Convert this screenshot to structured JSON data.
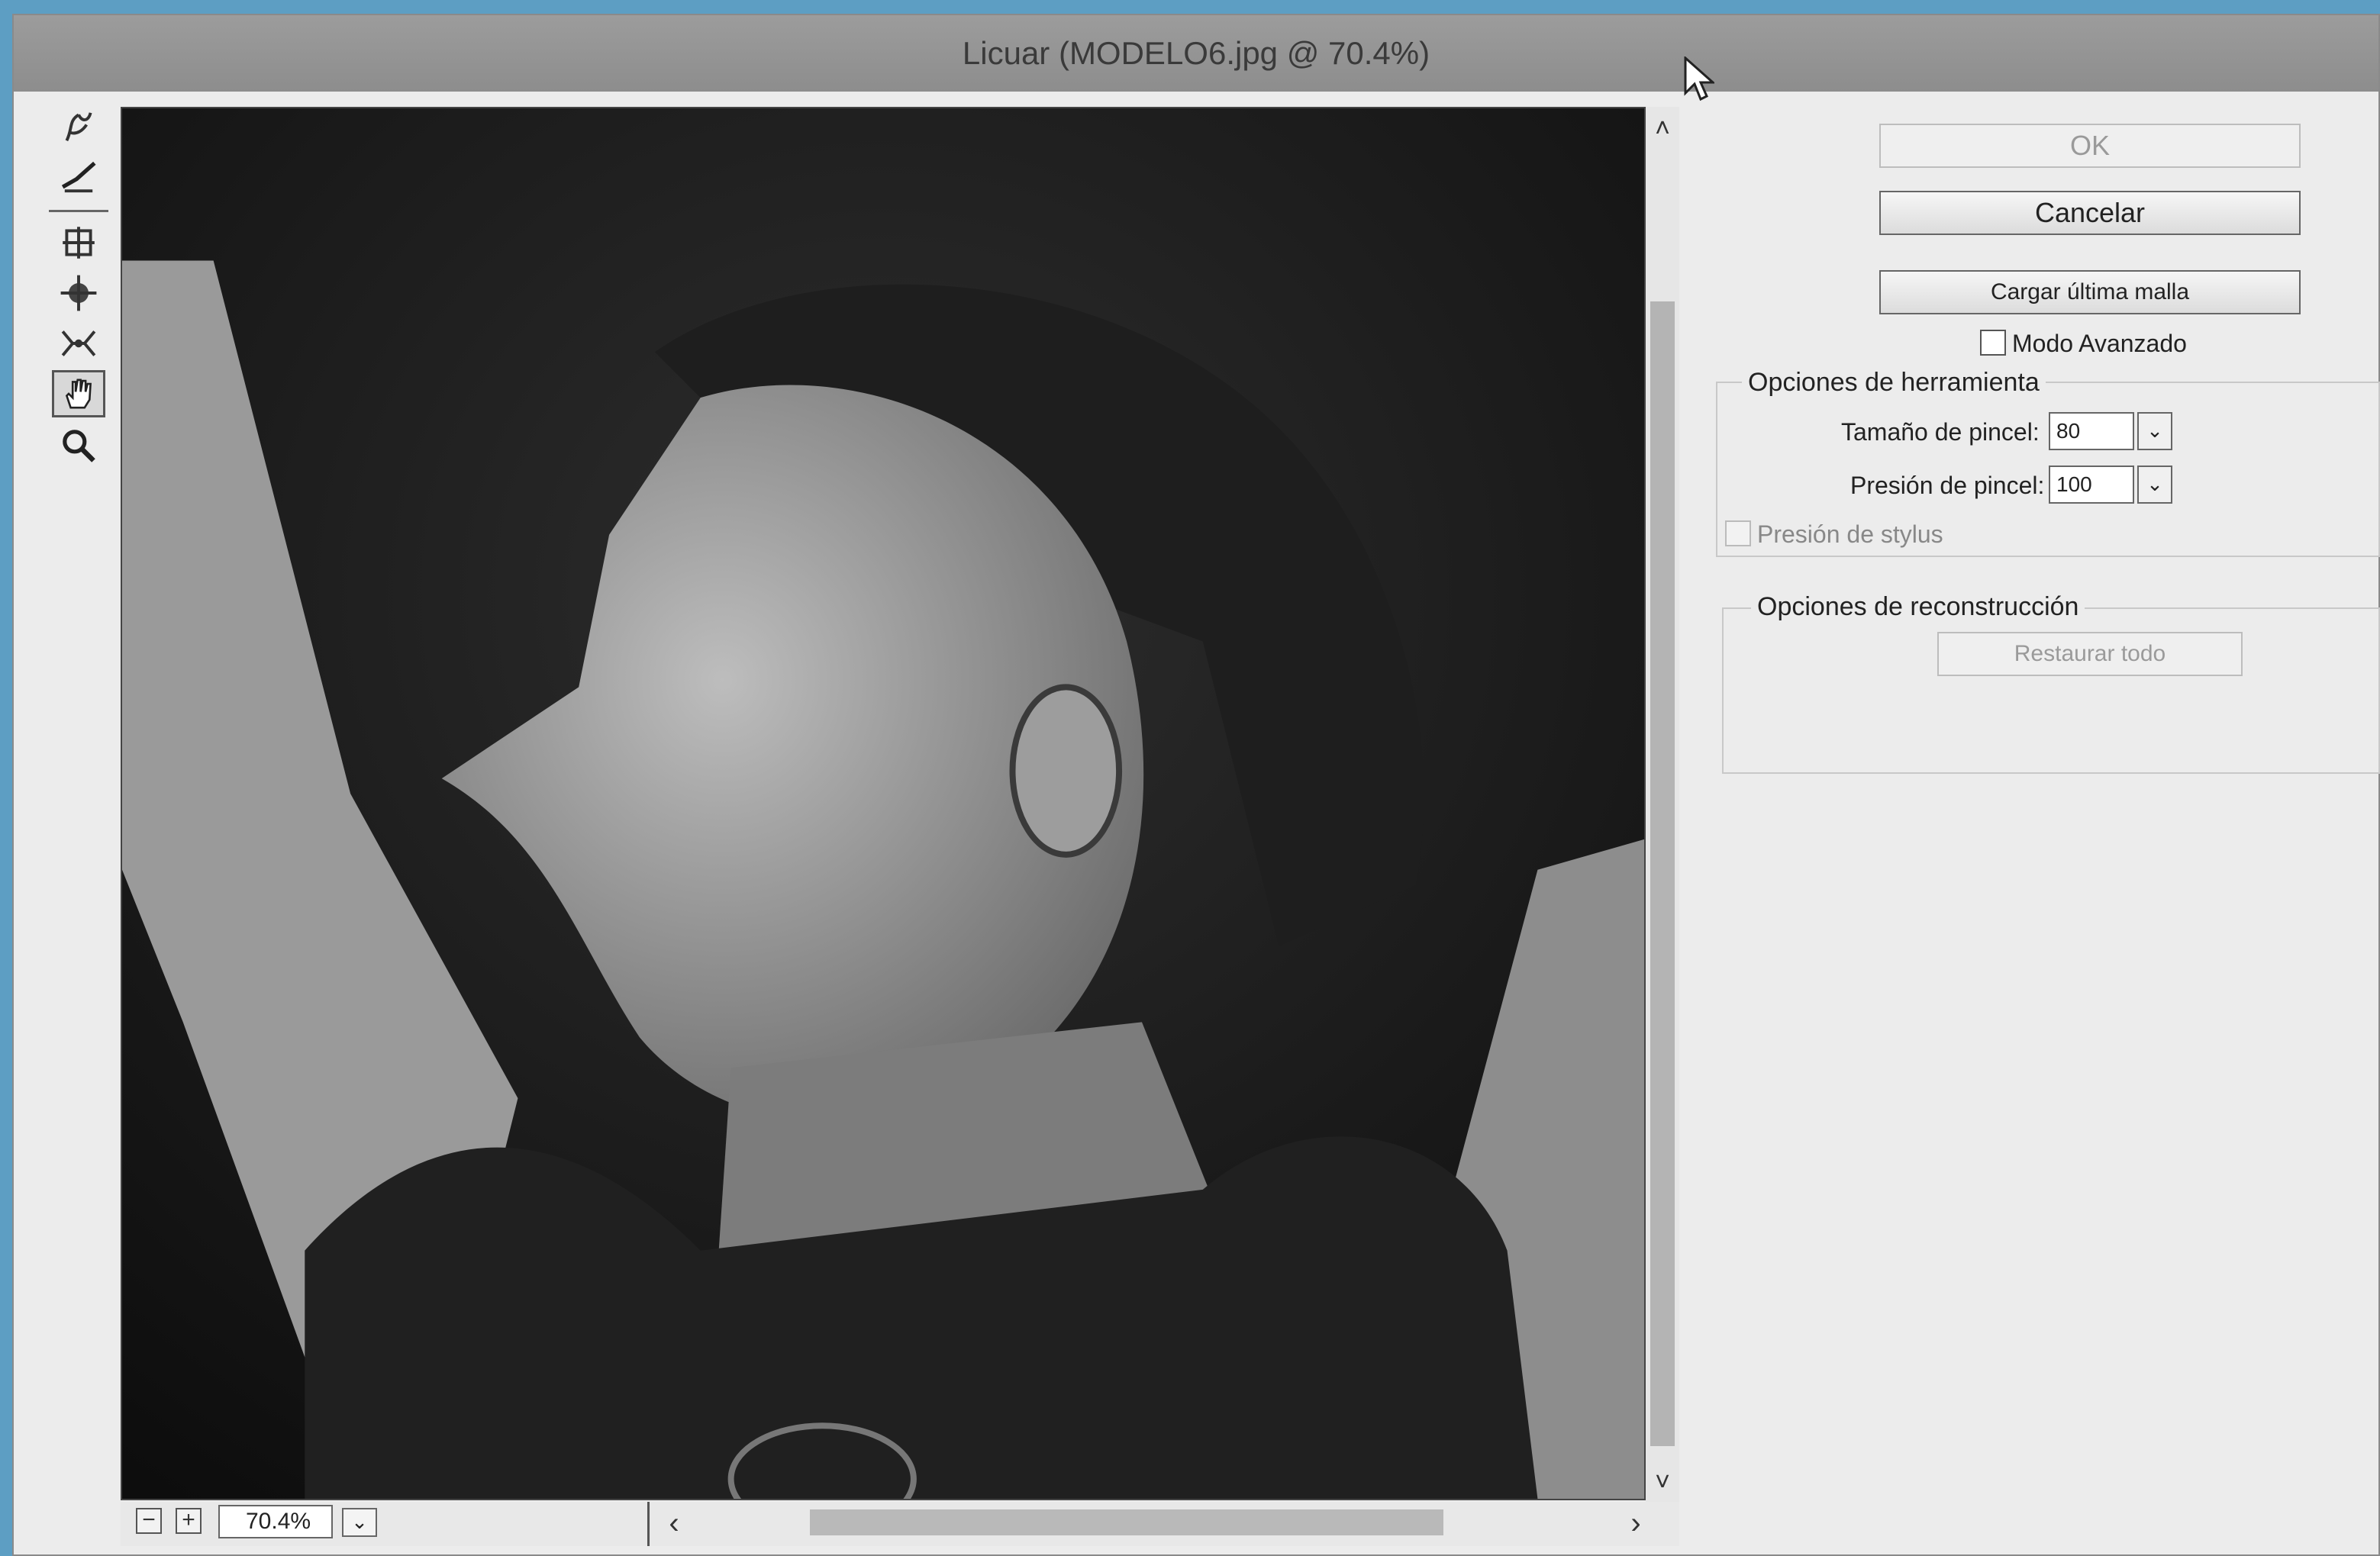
{
  "window": {
    "title": "Licuar (MODELO6.jpg @ 70.4%)"
  },
  "toolbar": {
    "tools": [
      {
        "name": "forward-warp-tool-icon"
      },
      {
        "name": "reconstruct-tool-icon"
      },
      {
        "name": "pucker-tool-icon"
      },
      {
        "name": "bloat-tool-icon"
      },
      {
        "name": "push-left-tool-icon"
      },
      {
        "name": "hand-tool-icon",
        "active": true
      },
      {
        "name": "zoom-tool-icon"
      }
    ]
  },
  "bottom": {
    "zoom_out": "−",
    "zoom_in": "+",
    "zoom_value": "70.4%",
    "dropdown_glyph": "⌄",
    "scroll_left": "‹",
    "scroll_right": "›"
  },
  "scroll": {
    "up": "˄",
    "down": "˅"
  },
  "panel": {
    "ok_label": "OK",
    "cancel_label": "Cancelar",
    "load_mesh_label": "Cargar última malla",
    "advanced_mode_label": "Modo Avanzado",
    "tool_options": {
      "legend": "Opciones de herramienta",
      "brush_size_label": "Tamaño de pincel:",
      "brush_size_value": "80",
      "brush_pressure_label": "Presión de pincel:",
      "brush_pressure_value": "100",
      "stylus_pressure_label": "Presión de stylus"
    },
    "reconstruct_options": {
      "legend": "Opciones de reconstrucción",
      "restore_all_label": "Restaurar todo"
    },
    "dropdown_glyph": "⌄"
  }
}
